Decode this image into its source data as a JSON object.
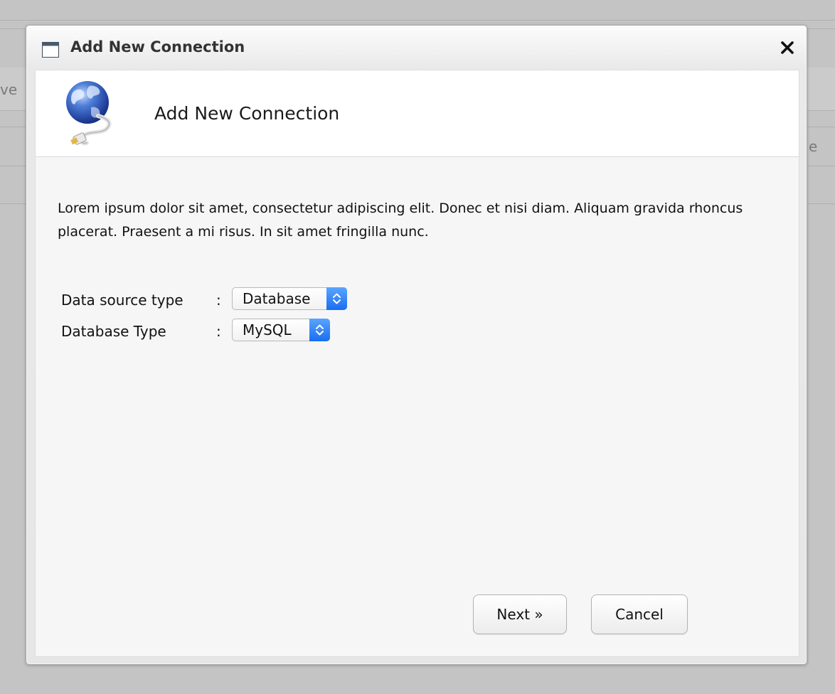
{
  "background": {
    "left_text": "ve",
    "right_text": "e"
  },
  "dialog": {
    "title": "Add New Connection",
    "close_symbol": "✕",
    "header": {
      "title": "Add New Connection",
      "icon": "globe-network-cable-icon"
    },
    "description": "Lorem ipsum dolor sit amet, consectetur adipiscing elit. Donec et nisi diam. Aliquam gravida rhoncus placerat. Praesent a mi risus. In sit amet fringilla nunc.",
    "form": {
      "data_source_type": {
        "label": "Data source type",
        "colon": ":",
        "value": "Database"
      },
      "database_type": {
        "label": "Database Type",
        "colon": ":",
        "value": "MySQL"
      }
    },
    "buttons": {
      "next": "Next »",
      "cancel": "Cancel"
    }
  },
  "colors": {
    "select_arrow": "#1a6df0",
    "title_text": "#333333"
  }
}
